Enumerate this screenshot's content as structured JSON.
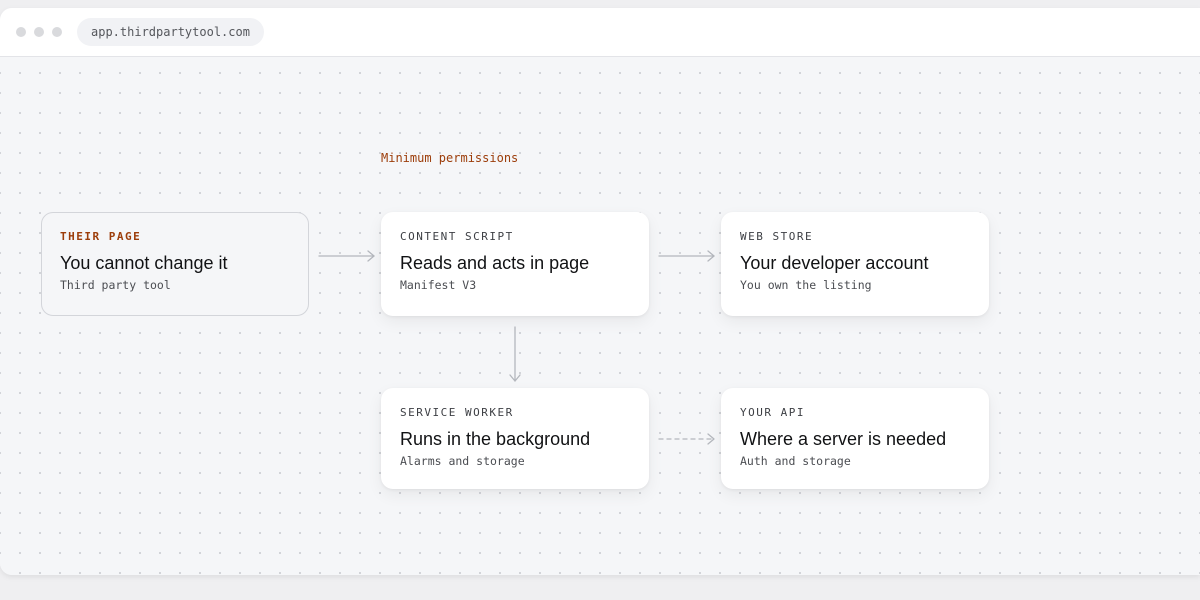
{
  "browser": {
    "url": "app.thirdpartytool.com"
  },
  "annotation": "Minimum permissions",
  "cards": {
    "their_page": {
      "eyebrow": "THEIR PAGE",
      "title": "You cannot change it",
      "subtitle": "Third party tool"
    },
    "content_script": {
      "eyebrow": "CONTENT SCRIPT",
      "title": "Reads and acts in page",
      "subtitle": "Manifest V3"
    },
    "web_store": {
      "eyebrow": "WEB STORE",
      "title": "Your developer account",
      "subtitle": "You own the listing"
    },
    "service_worker": {
      "eyebrow": "SERVICE WORKER",
      "title": "Runs in the background",
      "subtitle": "Alarms and storage"
    },
    "your_api": {
      "eyebrow": "YOUR API",
      "title": "Where a server is needed",
      "subtitle": "Auth and storage"
    }
  },
  "colors": {
    "accent": "#9c3d0a",
    "arrow": "#b4b7bd",
    "background": "#f5f6f8",
    "card": "#ffffff"
  }
}
